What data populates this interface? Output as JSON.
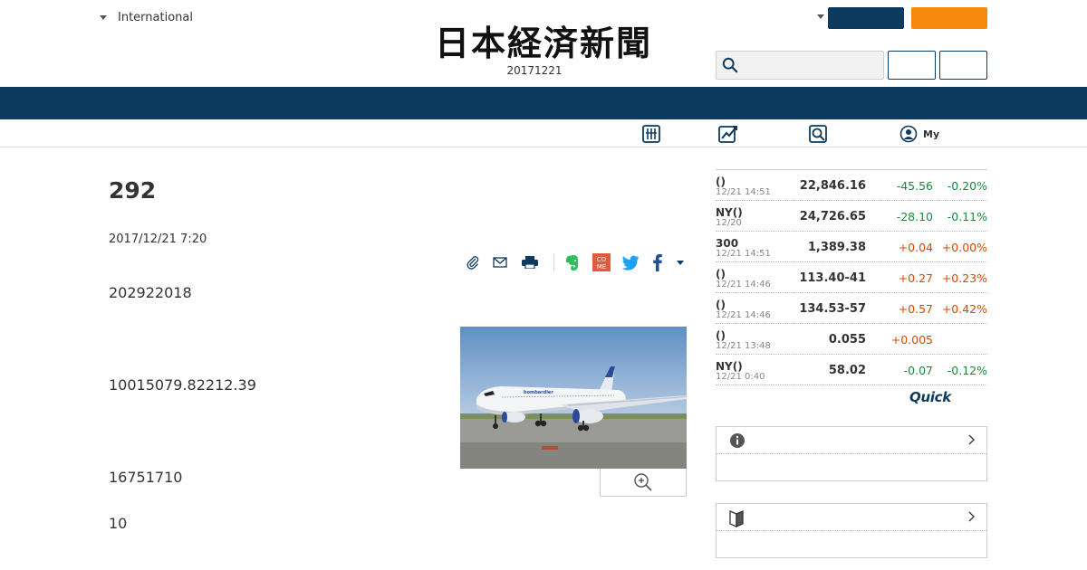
{
  "header": {
    "region_label": "International",
    "logo_text": "日本経済新聞",
    "edition_date": "20171221",
    "search": {
      "placeholder": ""
    },
    "nav_color": "#0d3a5f",
    "accent_color": "#f5890c"
  },
  "subnav": {
    "items": [
      {
        "icon": "newspaper-grid-icon"
      },
      {
        "icon": "chart-trend-icon"
      },
      {
        "icon": "search-doc-icon"
      },
      {
        "icon": "user-circle-icon",
        "label": "My"
      }
    ]
  },
  "article": {
    "headline": "292",
    "published": "2017/12/21 7:20",
    "paragraphs": [
      "202922018",
      "10015079.82212.39",
      "16751710",
      "10"
    ],
    "photo_icon": "airplane-photo",
    "share_icons": [
      "clip-icon",
      "mail-icon",
      "print-icon",
      "evernote-icon",
      "come-icon",
      "twitter-icon",
      "facebook-icon",
      "more-caret-icon"
    ],
    "come_label": "CO ME"
  },
  "market": {
    "rows": [
      {
        "name": "()",
        "time": "12/21 14:51",
        "value": "22,846.16",
        "change": "-45.56",
        "pct": "-0.20%",
        "dir": "neg"
      },
      {
        "name": "NY()",
        "time": "12/20",
        "value": "24,726.65",
        "change": "-28.10",
        "pct": "-0.11%",
        "dir": "neg"
      },
      {
        "name": "300",
        "time": "12/21 14:51",
        "value": "1,389.38",
        "change": "+0.04",
        "pct": "+0.00%",
        "dir": "pos"
      },
      {
        "name": "()",
        "time": "12/21 14:46",
        "value": "113.40-41",
        "change": "+0.27",
        "pct": "+0.23%",
        "dir": "pos"
      },
      {
        "name": "()",
        "time": "12/21 14:46",
        "value": "134.53-57",
        "change": "+0.57",
        "pct": "+0.42%",
        "dir": "pos"
      },
      {
        "name": "()",
        "time": "12/21 13:48",
        "value": "0.055",
        "change": "+0.005",
        "pct": "",
        "dir": "pos"
      },
      {
        "name": "NY()",
        "time": "12/21 0:40",
        "value": "58.02",
        "change": "-0.07",
        "pct": "-0.12%",
        "dir": "neg"
      }
    ],
    "source_logo": "Quick"
  },
  "sidebar_boxes": [
    {
      "icon": "info-icon"
    },
    {
      "icon": "beginner-mark-icon"
    }
  ]
}
